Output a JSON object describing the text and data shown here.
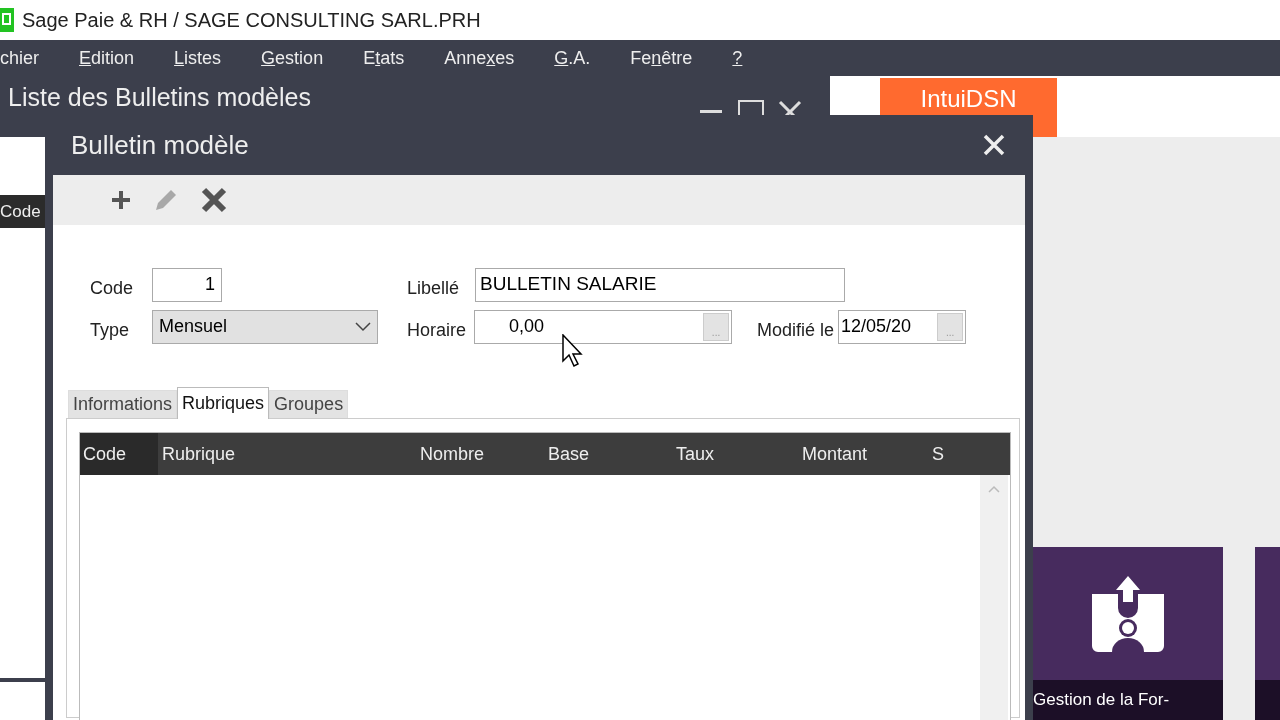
{
  "app_title": "Sage Paie & RH / SAGE CONSULTING SARL.PRH",
  "menu": [
    {
      "pre": "chier"
    },
    {
      "key": "E",
      "post": "dition"
    },
    {
      "key": "L",
      "post": "istes"
    },
    {
      "key": "G",
      "post": "estion"
    },
    {
      "pre": "E",
      "key": "t",
      "post": "ats"
    },
    {
      "pre": "Anne",
      "key": "x",
      "post": "es"
    },
    {
      "key": "G",
      "post": ".A."
    },
    {
      "pre": "Fe",
      "key": "n",
      "post": "être"
    },
    {
      "key": "?"
    }
  ],
  "background_window": {
    "title": "Liste des Bulletins modèles",
    "column": "Code"
  },
  "intuidsn_button": "IntuiDSN",
  "tiles": [
    {
      "label": "Gestion de la For-"
    }
  ],
  "dialog": {
    "title": "Bulletin modèle",
    "toolbar": [
      {
        "kind": "add",
        "disabled": false
      },
      {
        "kind": "edit",
        "disabled": true
      },
      {
        "kind": "delete",
        "disabled": false
      }
    ],
    "code": {
      "label": "Code",
      "value": "1"
    },
    "type": {
      "label": "Type",
      "value": "Mensuel"
    },
    "libelle": {
      "label": "Libellé",
      "value": "BULLETIN SALARIE"
    },
    "horaire": {
      "label": "Horaire",
      "value": "0,00",
      "button": "..."
    },
    "modifie": {
      "label": "Modifié le",
      "value": "12/05/20",
      "button": "..."
    },
    "tabs": [
      {
        "label": "Informations",
        "selected": false
      },
      {
        "label": "Rubriques",
        "selected": true
      },
      {
        "label": "Groupes",
        "selected": false
      }
    ],
    "grid": {
      "columns": [
        "Code",
        "Rubrique",
        "Nombre",
        "Base",
        "Taux",
        "Montant",
        "S"
      ]
    }
  }
}
